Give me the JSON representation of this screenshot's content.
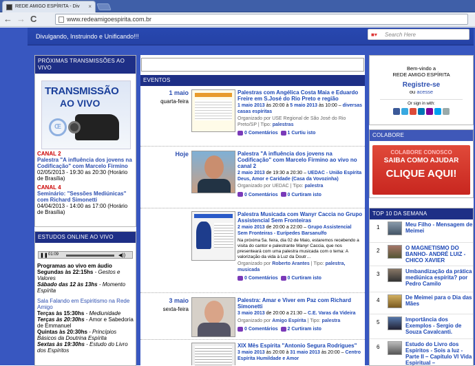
{
  "browser": {
    "tab_title": "REDE AMIGO ESPÍRITA - Div",
    "tab_close": "×",
    "url": "www.redeamigoespirita.com.br",
    "back": "←",
    "forward": "→",
    "reload": "C"
  },
  "header": {
    "tagline": "Divulgando, Instruindo e Unificando!!!",
    "search_placeholder": "Search Here"
  },
  "left": {
    "transmissoes_title": "PRÓXIMAS TRANSMISSÕES AO VIVO",
    "banner_line1": "TRANSMISSÃO",
    "banner_line2": "AO VIVO",
    "canal2_label": "CANAL 2",
    "canal2_title": "Palestra \"A influência dos jovens na Codificação\" com Marcelo Firmino",
    "canal2_time": "02/05/2013 - 19:30 as 20:30 (Horário de Brasília)",
    "canal4_label": "CANAL 4",
    "canal4_title": "Seminário: \"Sessões Mediúnicas\" com Richard Simonetti",
    "canal4_time": "04/04/2013 - 14:00 as 17:00 (Horário de Brasília)",
    "estudos_title": "ESTUDOS ONLINE AO VIVO",
    "player_time": "01:09",
    "prog_title": "Programas ao vivo em áudio",
    "prog_l1a": "Segundas às 22:15hs",
    "prog_l1b": " - Gestos e Valores",
    "prog_l2a": "Sábado das 12 às 13hs",
    "prog_l2b": " - Momento Espírita",
    "sala_title": "Sala Falando em Espiritismo na Rede Amigo",
    "sala_l1a": "Terças às 15:30hs",
    "sala_l1b": " - Mediunidade",
    "sala_l2a": "Terças às 20:30hs",
    "sala_l2b": " - Amor e Sabedoria de Emmanuel",
    "sala_l3a": "Quintas às 20:30hs",
    "sala_l3b": " - Princípios Básicos da Doutrina Espírita",
    "sala_l4a": "Sextas às 19:30hs",
    "sala_l4b": " - Estudo do Livro dos Espíritos"
  },
  "events": {
    "title": "EVENTOS",
    "items": [
      {
        "date": "1 maio",
        "weekday": "quarta-feira",
        "title": "Palestras com Angélica Costa Maia e Eduardo Freire em S.José do Rio Preto e região",
        "when_a": "1 maio 2013",
        "when_b": " às 20:00 à ",
        "when_c": "5 maio 2013",
        "when_d": " às 10:00 – ",
        "place": "diversas casas espíritas",
        "org": "Organizado por USE Regional de São José do Rio Preto/SP | Tipo: ",
        "tipo": "palestras",
        "comments": "0 Comentários",
        "likes": "1 Curtiu isto"
      },
      {
        "date": "Hoje",
        "weekday": "",
        "title": "Palestra \"A influência dos jovens na Codificação\" com Marcelo Firmino ao vivo no canal 2",
        "when_a": "2 maio 2013",
        "when_b": " de 19:30 a 20:30 – ",
        "when_c": "",
        "when_d": "",
        "place": "UEDAC - União Espírita Deus, Amor e Caridade (Casa da Vovozinha)",
        "org": "Organizado por UEDAC | Tipo: ",
        "tipo": "palestra",
        "comments": "0 Comentários",
        "likes": "0 Curtiram isto"
      },
      {
        "date": "",
        "weekday": "",
        "title": "Palestra Musicada com Wanyr Caccia no Grupo Assistencial Sem Fronteiras",
        "when_a": "2 maio 2013",
        "when_b": " de 20:00 a 22:00 – ",
        "when_c": "",
        "when_d": "",
        "place": "Grupo Assistencial Sem Fronteiras - Eurípedes Barsanulfo",
        "desc": "Na próxima 5a. feira, dia 02 de Maio, estaremos recebendo a visita do cantor e palestrante Wanyr Caccia, que nos presenteará com uma palestra musicada com o tema: A valorização da vida à Luz da Doutr…",
        "org": "Organizado por ",
        "org_link": "Roberto Arantes",
        "org_tail": " | Tipo: ",
        "tipo": "palestra, musicada",
        "comments": "0 Comentários",
        "likes": "0 Curtiram isto"
      },
      {
        "date": "3 maio",
        "weekday": "sexta-feira",
        "title": "Palestra: Amar e Viver em Paz com Richard Simonetti",
        "when_a": "3 maio 2013",
        "when_b": " de 20:00 a 21:30 – ",
        "when_c": "",
        "when_d": "",
        "place": "C.E. Varas da Videira",
        "org": "Organizado por ",
        "org_link": "Amigo Espírita",
        "org_tail": " | Tipo: ",
        "tipo": "palestra",
        "comments": "0 Comentários",
        "likes": "2 Curtiram isto"
      },
      {
        "date": "",
        "weekday": "",
        "title": "XIX Mês Espírita \"Antonio Segura Rodrigues\"",
        "when_a": "3 maio 2013",
        "when_b": " às 20:00 à ",
        "when_c": "31 maio 2013",
        "when_d": " às 20:00 – ",
        "place": "Centro Espírita Humildade e Amor",
        "org": "",
        "tipo": "",
        "comments": "",
        "likes": ""
      }
    ]
  },
  "right": {
    "welcome_1": "Bem-vindo a",
    "welcome_2": "REDE AMIGO ESPÍRITA",
    "register": "Registre-se",
    "or": "ou ",
    "access": "acesse",
    "signin": "Or sign in with:",
    "colabore_title": "COLABORE",
    "colabore_1": "COLABORE CONOSCO",
    "colabore_2": "SAIBA COMO AJUDAR",
    "colabore_3": "CLIQUE AQUI!",
    "top_title": "TOP 10 DA SEMANA",
    "top": [
      {
        "n": "1",
        "t": "Meu Filho - Mensagem de Meimei"
      },
      {
        "n": "2",
        "t": "O MAGNETISMO DO BANHO- ANDRÉ LUIZ - CHICO XAVIER"
      },
      {
        "n": "3",
        "t": "Umbandização da prática mediúnica espírita? por Pedro Camilo"
      },
      {
        "n": "4",
        "t": "De Meimei para o Dia das Mães"
      },
      {
        "n": "5",
        "t": "Importância dos Exemplos - Sergio de Souza Cavalcanti."
      },
      {
        "n": "6",
        "t": "Estudo do Livro dos Espíritos - Sois a luz - Parte II – Capítulo VI Vida Espiritual –"
      }
    ]
  }
}
